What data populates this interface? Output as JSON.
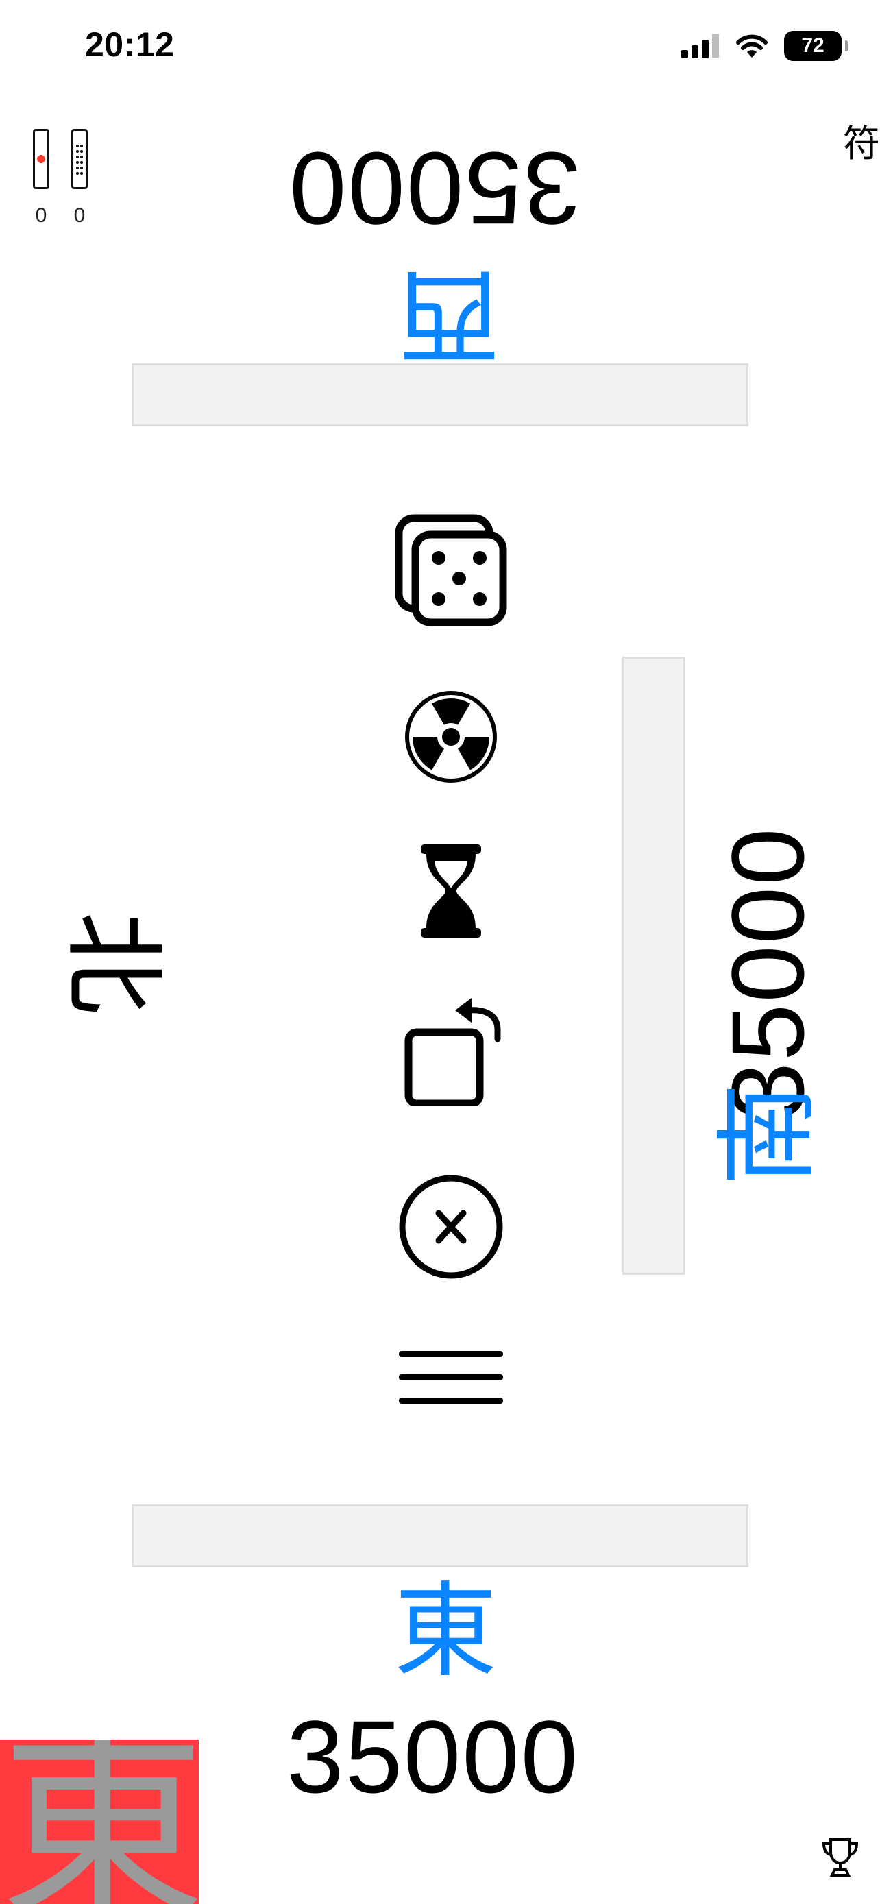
{
  "status_bar": {
    "time": "20:12",
    "battery_level": "72",
    "icons": [
      "cellular-signal-icon",
      "wifi-icon",
      "battery-icon"
    ]
  },
  "counters": {
    "riichi_sticks": "0",
    "honba_sticks": "0"
  },
  "fu_label": "符",
  "players": {
    "west": {
      "wind": "西",
      "score": "35000"
    },
    "north": {
      "wind": "北"
    },
    "south": {
      "wind": "南",
      "score": "35000"
    },
    "east": {
      "wind": "東",
      "score": "35000"
    }
  },
  "dealer_badge": "東",
  "center_icons": [
    "dice-icon",
    "radiation-icon",
    "hourglass-icon",
    "rotate-icon",
    "close-circle-icon",
    "menu-icon"
  ],
  "colors": {
    "accent": "#0a84ff",
    "dealer_badge_bg": "#ff3b40",
    "dealer_badge_text": "#9a9a9a",
    "riichi_bar_bg": "#f2f2f2"
  }
}
